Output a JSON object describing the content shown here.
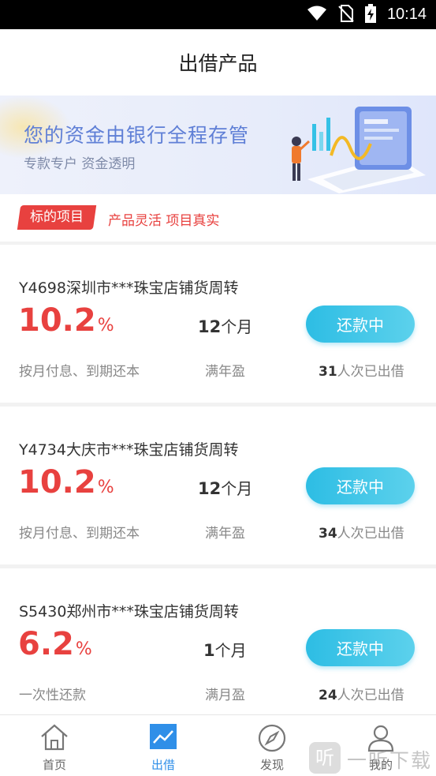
{
  "status_bar": {
    "time": "10:14",
    "icons": [
      "wifi-icon",
      "no-sim-icon",
      "battery-charging-icon"
    ]
  },
  "header": {
    "title": "出借产品"
  },
  "banner": {
    "title": "您的资金由银行全程存管",
    "subtitle": "专款专户  资金透明"
  },
  "section": {
    "badge": "标的项目",
    "tagline": "产品灵活 项目真实"
  },
  "products": [
    {
      "title": "Y4698深圳市***珠宝店铺货周转",
      "rate": "10.2",
      "rate_unit": "%",
      "term": "12",
      "term_unit": "个月",
      "status": "还款中",
      "repayment": "按月付息、到期还本",
      "condition": "满年盈",
      "investors": "31",
      "investors_suffix": "人次已出借"
    },
    {
      "title": "Y4734大庆市***珠宝店铺货周转",
      "rate": "10.2",
      "rate_unit": "%",
      "term": "12",
      "term_unit": "个月",
      "status": "还款中",
      "repayment": "按月付息、到期还本",
      "condition": "满年盈",
      "investors": "34",
      "investors_suffix": "人次已出借"
    },
    {
      "title": "S5430郑州市***珠宝店铺货周转",
      "rate": "6.2",
      "rate_unit": "%",
      "term": "1",
      "term_unit": "个月",
      "status": "还款中",
      "repayment": "一次性还款",
      "condition": "满月盈",
      "investors": "24",
      "investors_suffix": "人次已出借"
    }
  ],
  "tabbar": {
    "items": [
      {
        "label": "首页",
        "icon": "home-icon"
      },
      {
        "label": "出借",
        "icon": "chart-trend-icon"
      },
      {
        "label": "发现",
        "icon": "compass-icon"
      },
      {
        "label": "我的",
        "icon": "user-icon"
      }
    ]
  },
  "colors": {
    "accent_red": "#e8413f",
    "button_blue": "#2dbde4",
    "tab_active": "#2f8fe8"
  },
  "watermark": {
    "text": "一听下载"
  }
}
